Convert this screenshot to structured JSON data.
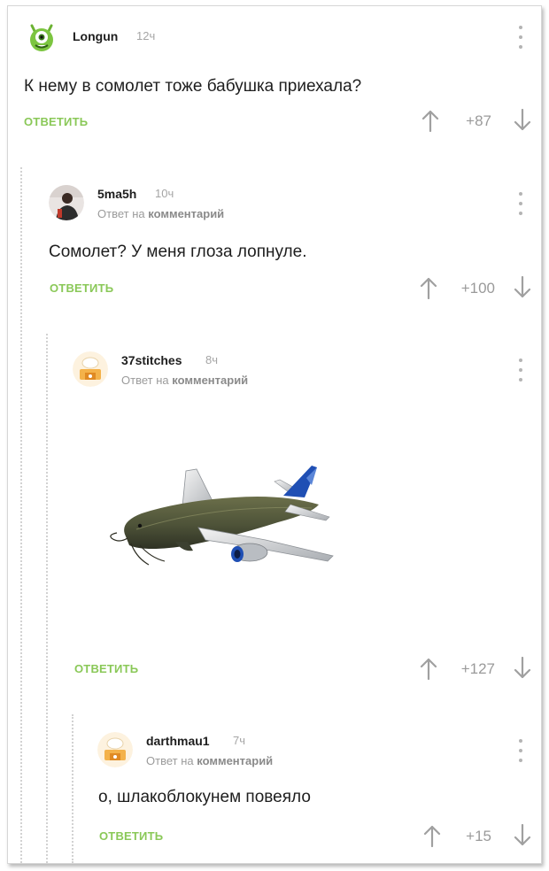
{
  "comments": [
    {
      "username": "Longun",
      "time": "12ч",
      "reply_prefix": "",
      "reply_target": "",
      "text": "К нему в сомолет тоже бабушка приехала?",
      "reply_label": "ОТВЕТИТЬ",
      "rating": "+87",
      "avatar": "green-one-eyed-monster-avatar"
    },
    {
      "username": "5ma5h",
      "time": "10ч",
      "reply_prefix": "Ответ на",
      "reply_target": "комментарий",
      "text": "Сомолет? У меня глоза лопнуле.",
      "reply_label": "ОТВЕТИТЬ",
      "rating": "+100",
      "avatar": "person-photo-avatar"
    },
    {
      "username": "37stitches",
      "time": "8ч",
      "reply_prefix": "Ответ на",
      "reply_target": "комментарий",
      "text": "",
      "attachment": "catfish-airplane-image",
      "reply_label": "ОТВЕТИТЬ",
      "rating": "+127",
      "avatar": "default-chef-avatar"
    },
    {
      "username": "darthmau1",
      "time": "7ч",
      "reply_prefix": "Ответ на",
      "reply_target": "комментарий",
      "text": "о, шлакоблокунем повеяло",
      "reply_label": "ОТВЕТИТЬ",
      "rating": "+15",
      "avatar": "default-chef-avatar"
    }
  ],
  "colors": {
    "reply_green": "#8ac858",
    "meta_gray": "#a5a5a5",
    "thread_line": "#d2d2d2"
  },
  "icons": {
    "upvote": "arrow-up-icon",
    "downvote": "arrow-down-icon",
    "more": "vertical-dots-icon"
  }
}
